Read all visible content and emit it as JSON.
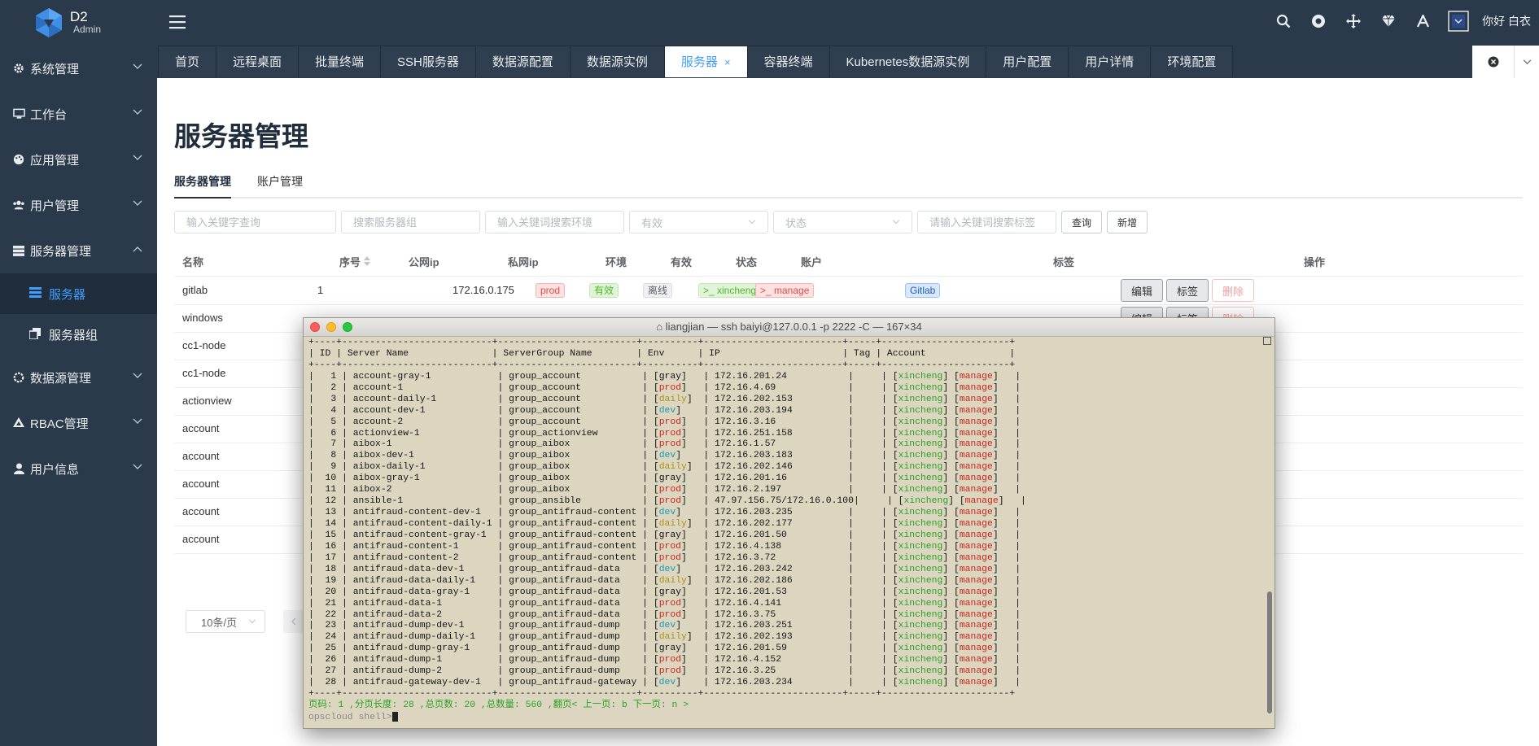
{
  "app": {
    "logo_big": "D2",
    "logo_small": "Admin",
    "greeting": "你好 白衣"
  },
  "sidebar": {
    "items": [
      {
        "label": "系统管理",
        "icon": "gear-icon"
      },
      {
        "label": "工作台",
        "icon": "monitor-icon"
      },
      {
        "label": "应用管理",
        "icon": "palette-icon"
      },
      {
        "label": "用户管理",
        "icon": "users-icon"
      },
      {
        "label": "服务器管理",
        "icon": "server-icon"
      },
      {
        "label": "数据源管理",
        "icon": "database-icon"
      },
      {
        "label": "RBAC管理",
        "icon": "shield-icon"
      },
      {
        "label": "用户信息",
        "icon": "user-icon"
      }
    ],
    "sub": [
      {
        "label": "服务器",
        "icon": "list-icon",
        "active": true
      },
      {
        "label": "服务器组",
        "icon": "copy-icon",
        "active": false
      }
    ]
  },
  "tabs": [
    {
      "label": "首页"
    },
    {
      "label": "远程桌面"
    },
    {
      "label": "批量终端"
    },
    {
      "label": "SSH服务器"
    },
    {
      "label": "数据源配置"
    },
    {
      "label": "数据源实例"
    },
    {
      "label": "服务器",
      "active": true,
      "close": "×"
    },
    {
      "label": "容器终端"
    },
    {
      "label": "Kubernetes数据源实例"
    },
    {
      "label": "用户配置"
    },
    {
      "label": "用户详情"
    },
    {
      "label": "环境配置"
    }
  ],
  "page": {
    "title": "服务器管理",
    "subtabs": [
      "服务器管理",
      "账户管理"
    ],
    "filters": {
      "keyword_placeholder": "输入关键字查询",
      "group_placeholder": "搜索服务器组",
      "env_placeholder": "输入关键词搜索环境",
      "valid_placeholder": "有效",
      "status_placeholder": "状态",
      "tag_placeholder": "请输入关键词搜索标签",
      "query_label": "查询",
      "add_label": "新增"
    },
    "columns": [
      "名称",
      "序号",
      "公网ip",
      "私网ip",
      "环境",
      "有效",
      "状态",
      "账户",
      "标签",
      "操作"
    ],
    "row_names": [
      "gitlab",
      "windows",
      "cc1-node",
      "cc1-node",
      "actionview",
      "account",
      "account",
      "account",
      "account",
      "account"
    ],
    "row1": {
      "serial": "1",
      "private_ip": "172.16.0.175",
      "env": "prod",
      "valid": "有效",
      "status": "离线",
      "acct1": "xincheng",
      "acct2": "manage",
      "tag": "Gitlab"
    },
    "ops": {
      "edit": "编辑",
      "tag": "标签",
      "delete": "删除"
    },
    "page_size": "10条/页"
  },
  "terminal": {
    "title": "liangjian — ssh baiyi@127.0.0.1 -p 2222 -C — 167×34",
    "header": {
      "id": "ID",
      "name": "Server Name",
      "group": "ServerGroup Name",
      "env": "Env",
      "ip": "IP",
      "tag": "Tag",
      "account": "Account"
    },
    "rows": [
      [
        "1",
        "account-gray-1",
        "group_account",
        "gray",
        "172.16.201.24"
      ],
      [
        "2",
        "account-1",
        "group_account",
        "prod",
        "172.16.4.69"
      ],
      [
        "3",
        "account-daily-1",
        "group_account",
        "daily",
        "172.16.202.153"
      ],
      [
        "4",
        "account-dev-1",
        "group_account",
        "dev",
        "172.16.203.194"
      ],
      [
        "5",
        "account-2",
        "group_account",
        "prod",
        "172.16.3.16"
      ],
      [
        "6",
        "actionview-1",
        "group_actionview",
        "prod",
        "172.16.251.158"
      ],
      [
        "7",
        "aibox-1",
        "group_aibox",
        "prod",
        "172.16.1.57"
      ],
      [
        "8",
        "aibox-dev-1",
        "group_aibox",
        "dev",
        "172.16.203.183"
      ],
      [
        "9",
        "aibox-daily-1",
        "group_aibox",
        "daily",
        "172.16.202.146"
      ],
      [
        "10",
        "aibox-gray-1",
        "group_aibox",
        "gray",
        "172.16.201.16"
      ],
      [
        "11",
        "aibox-2",
        "group_aibox",
        "prod",
        "172.16.2.197"
      ],
      [
        "12",
        "ansible-1",
        "group_ansible",
        "prod",
        "47.97.156.75/172.16.0.100"
      ],
      [
        "13",
        "antifraud-content-dev-1",
        "group_antifraud-content",
        "dev",
        "172.16.203.235"
      ],
      [
        "14",
        "antifraud-content-daily-1",
        "group_antifraud-content",
        "daily",
        "172.16.202.177"
      ],
      [
        "15",
        "antifraud-content-gray-1",
        "group_antifraud-content",
        "gray",
        "172.16.201.50"
      ],
      [
        "16",
        "antifraud-content-1",
        "group_antifraud-content",
        "prod",
        "172.16.4.138"
      ],
      [
        "17",
        "antifraud-content-2",
        "group_antifraud-content",
        "prod",
        "172.16.3.72"
      ],
      [
        "18",
        "antifraud-data-dev-1",
        "group_antifraud-data",
        "dev",
        "172.16.203.242"
      ],
      [
        "19",
        "antifraud-data-daily-1",
        "group_antifraud-data",
        "daily",
        "172.16.202.186"
      ],
      [
        "20",
        "antifraud-data-gray-1",
        "group_antifraud-data",
        "gray",
        "172.16.201.53"
      ],
      [
        "21",
        "antifraud-data-1",
        "group_antifraud-data",
        "prod",
        "172.16.4.141"
      ],
      [
        "22",
        "antifraud-data-2",
        "group_antifraud-data",
        "prod",
        "172.16.3.75"
      ],
      [
        "23",
        "antifraud-dump-dev-1",
        "group_antifraud-dump",
        "dev",
        "172.16.203.251"
      ],
      [
        "24",
        "antifraud-dump-daily-1",
        "group_antifraud-dump",
        "daily",
        "172.16.202.193"
      ],
      [
        "25",
        "antifraud-dump-gray-1",
        "group_antifraud-dump",
        "gray",
        "172.16.201.59"
      ],
      [
        "26",
        "antifraud-dump-1",
        "group_antifraud-dump",
        "prod",
        "172.16.4.152"
      ],
      [
        "27",
        "antifraud-dump-2",
        "group_antifraud-dump",
        "prod",
        "172.16.3.25"
      ],
      [
        "28",
        "antifraud-gateway-dev-1",
        "group_antifraud-gateway",
        "dev",
        "172.16.203.234"
      ]
    ],
    "accounts": [
      "xincheng",
      "manage"
    ],
    "footer": "页码: 1 ,分页长度: 28 ,总页数: 20 ,总数量: 560 ,翻页< 上一页: b 下一页: n >",
    "prompt": "opscloud shell>"
  },
  "colors": {
    "sidebar_bg": "#2b3a4a",
    "accent": "#409eff",
    "terminal_bg": "#dcd5c0"
  }
}
